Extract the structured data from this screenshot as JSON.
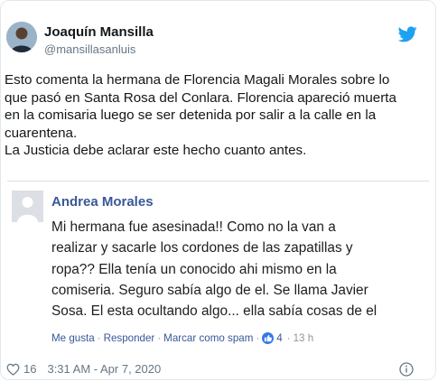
{
  "author": {
    "name": "Joaquín Mansilla",
    "handle": "@mansillasanluis"
  },
  "tweet": {
    "lines": [
      "Esto comenta la hermana de Florencia Magali Morales sobre lo",
      "que pasó en Santa Rosa del Conlara. Florencia apareció muerta",
      "en la comisaria luego se ser detenida por salir a la calle en la",
      "cuarentena.",
      "La Justicia debe aclarar este hecho cuanto antes."
    ]
  },
  "embedded_comment": {
    "author": "Andrea Morales",
    "lines": [
      "Mi hermana fue asesinada!! Como no la van a",
      "realizar y sacarle los cordones de las zapatillas y",
      "ropa?? Ella tenía un conocido ahi mismo en la",
      "comiseria. Seguro sabía algo de el. Se llama Javier",
      "Sosa. El esta ocultando algo... ella sabía cosas de el"
    ],
    "actions": {
      "like": "Me gusta",
      "reply": "Responder",
      "mark_spam": "Marcar como spam",
      "reaction_count": "4",
      "time": "13 h"
    },
    "separator": "·"
  },
  "footer": {
    "likes": "16",
    "timestamp": "3:31 AM - Apr 7, 2020"
  },
  "colors": {
    "twitter_blue": "#1da1f2",
    "fb_link": "#385898",
    "muted": "#657786"
  },
  "icons": [
    "twitter-logo-icon",
    "heart-icon",
    "info-icon",
    "facebook-like-icon"
  ]
}
